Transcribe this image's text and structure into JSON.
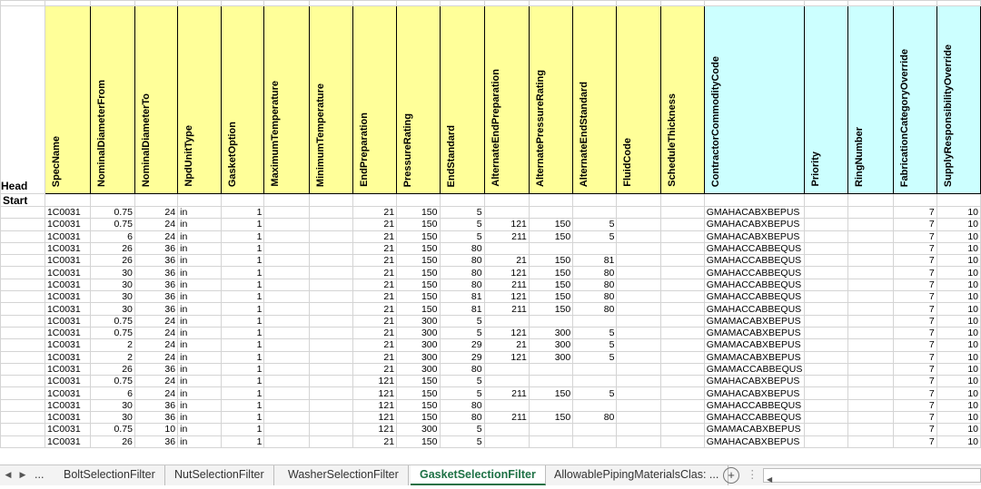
{
  "header_row": {
    "row_label": "Head",
    "columns": [
      {
        "label": "SpecName",
        "color": "yellow"
      },
      {
        "label": "NominalDiameterFrom",
        "color": "yellow"
      },
      {
        "label": "NominalDiameterTo",
        "color": "yellow"
      },
      {
        "label": "NpdUnitType",
        "color": "yellow"
      },
      {
        "label": "GasketOption",
        "color": "yellow"
      },
      {
        "label": "MaximumTemperature",
        "color": "yellow"
      },
      {
        "label": "MinimumTemperature",
        "color": "yellow"
      },
      {
        "label": "EndPreparation",
        "color": "yellow"
      },
      {
        "label": "PressureRating",
        "color": "yellow"
      },
      {
        "label": "EndStandard",
        "color": "yellow"
      },
      {
        "label": "AlternateEndPreparation",
        "color": "yellow"
      },
      {
        "label": "AlternatePressureRating",
        "color": "yellow"
      },
      {
        "label": "AlternateEndStandard",
        "color": "yellow"
      },
      {
        "label": "FluidCode",
        "color": "yellow"
      },
      {
        "label": "ScheduleThickness",
        "color": "yellow"
      },
      {
        "label": "ContractorCommodityCode",
        "color": "cyan"
      },
      {
        "label": "Priority",
        "color": "cyan"
      },
      {
        "label": "RingNumber",
        "color": "cyan"
      },
      {
        "label": "FabricationCategoryOverride",
        "color": "cyan"
      },
      {
        "label": "SupplyResponsibilityOverride",
        "color": "cyan"
      }
    ]
  },
  "start_label": "Start",
  "rows": [
    [
      "1C0031",
      "0.75",
      "24",
      "in",
      "1",
      "",
      "",
      "21",
      "150",
      "5",
      "",
      "",
      "",
      "",
      "",
      "GMAHACABXBEPUS",
      "",
      "",
      "7",
      "10"
    ],
    [
      "1C0031",
      "0.75",
      "24",
      "in",
      "1",
      "",
      "",
      "21",
      "150",
      "5",
      "121",
      "150",
      "5",
      "",
      "",
      "GMAHACABXBEPUS",
      "",
      "",
      "7",
      "10"
    ],
    [
      "1C0031",
      "6",
      "24",
      "in",
      "1",
      "",
      "",
      "21",
      "150",
      "5",
      "211",
      "150",
      "5",
      "",
      "",
      "GMAHACABXBEPUS",
      "",
      "",
      "7",
      "10"
    ],
    [
      "1C0031",
      "26",
      "36",
      "in",
      "1",
      "",
      "",
      "21",
      "150",
      "80",
      "",
      "",
      "",
      "",
      "",
      "GMAHACCABBEQUS",
      "",
      "",
      "7",
      "10"
    ],
    [
      "1C0031",
      "26",
      "36",
      "in",
      "1",
      "",
      "",
      "21",
      "150",
      "80",
      "21",
      "150",
      "81",
      "",
      "",
      "GMAHACCABBEQUS",
      "",
      "",
      "7",
      "10"
    ],
    [
      "1C0031",
      "30",
      "36",
      "in",
      "1",
      "",
      "",
      "21",
      "150",
      "80",
      "121",
      "150",
      "80",
      "",
      "",
      "GMAHACCABBEQUS",
      "",
      "",
      "7",
      "10"
    ],
    [
      "1C0031",
      "30",
      "36",
      "in",
      "1",
      "",
      "",
      "21",
      "150",
      "80",
      "211",
      "150",
      "80",
      "",
      "",
      "GMAHACCABBEQUS",
      "",
      "",
      "7",
      "10"
    ],
    [
      "1C0031",
      "30",
      "36",
      "in",
      "1",
      "",
      "",
      "21",
      "150",
      "81",
      "121",
      "150",
      "80",
      "",
      "",
      "GMAHACCABBEQUS",
      "",
      "",
      "7",
      "10"
    ],
    [
      "1C0031",
      "30",
      "36",
      "in",
      "1",
      "",
      "",
      "21",
      "150",
      "81",
      "211",
      "150",
      "80",
      "",
      "",
      "GMAHACCABBEQUS",
      "",
      "",
      "7",
      "10"
    ],
    [
      "1C0031",
      "0.75",
      "24",
      "in",
      "1",
      "",
      "",
      "21",
      "300",
      "5",
      "",
      "",
      "",
      "",
      "",
      "GMAMACABXBEPUS",
      "",
      "",
      "7",
      "10"
    ],
    [
      "1C0031",
      "0.75",
      "24",
      "in",
      "1",
      "",
      "",
      "21",
      "300",
      "5",
      "121",
      "300",
      "5",
      "",
      "",
      "GMAMACABXBEPUS",
      "",
      "",
      "7",
      "10"
    ],
    [
      "1C0031",
      "2",
      "24",
      "in",
      "1",
      "",
      "",
      "21",
      "300",
      "29",
      "21",
      "300",
      "5",
      "",
      "",
      "GMAMACABXBEPUS",
      "",
      "",
      "7",
      "10"
    ],
    [
      "1C0031",
      "2",
      "24",
      "in",
      "1",
      "",
      "",
      "21",
      "300",
      "29",
      "121",
      "300",
      "5",
      "",
      "",
      "GMAMACABXBEPUS",
      "",
      "",
      "7",
      "10"
    ],
    [
      "1C0031",
      "26",
      "36",
      "in",
      "1",
      "",
      "",
      "21",
      "300",
      "80",
      "",
      "",
      "",
      "",
      "",
      "GMAMACCABBEQUS",
      "",
      "",
      "7",
      "10"
    ],
    [
      "1C0031",
      "0.75",
      "24",
      "in",
      "1",
      "",
      "",
      "121",
      "150",
      "5",
      "",
      "",
      "",
      "",
      "",
      "GMAHACABXBEPUS",
      "",
      "",
      "7",
      "10"
    ],
    [
      "1C0031",
      "6",
      "24",
      "in",
      "1",
      "",
      "",
      "121",
      "150",
      "5",
      "211",
      "150",
      "5",
      "",
      "",
      "GMAHACABXBEPUS",
      "",
      "",
      "7",
      "10"
    ],
    [
      "1C0031",
      "30",
      "36",
      "in",
      "1",
      "",
      "",
      "121",
      "150",
      "80",
      "",
      "",
      "",
      "",
      "",
      "GMAHACCABBEQUS",
      "",
      "",
      "7",
      "10"
    ],
    [
      "1C0031",
      "30",
      "36",
      "in",
      "1",
      "",
      "",
      "121",
      "150",
      "80",
      "211",
      "150",
      "80",
      "",
      "",
      "GMAHACCABBEQUS",
      "",
      "",
      "7",
      "10"
    ],
    [
      "1C0031",
      "0.75",
      "10",
      "in",
      "1",
      "",
      "",
      "121",
      "300",
      "5",
      "",
      "",
      "",
      "",
      "",
      "GMAMACABXBEPUS",
      "",
      "",
      "7",
      "10"
    ],
    [
      "1C0031",
      "26",
      "36",
      "in",
      "1",
      "",
      "",
      "21",
      "150",
      "5",
      "",
      "",
      "",
      "",
      "",
      "GMAHACABXBEPUS",
      "",
      "",
      "7",
      "10"
    ]
  ],
  "tabs": {
    "nav_prev": "◀",
    "nav_next": "▶",
    "ellipsis": "...",
    "items": [
      "BoltSelectionFilter",
      "NutSelectionFilter",
      "WasherSelectionFilter",
      "GasketSelectionFilter",
      "AllowablePipingMaterialsClas: ..."
    ],
    "active": "GasketSelectionFilter",
    "add_label": "+",
    "more": "⋮",
    "scroll_left": "◀"
  },
  "colors": {
    "header_yellow": "#ffff99",
    "header_cyan": "#ccffff",
    "active_tab": "#1e7145",
    "gridline": "#d4d4d4"
  }
}
